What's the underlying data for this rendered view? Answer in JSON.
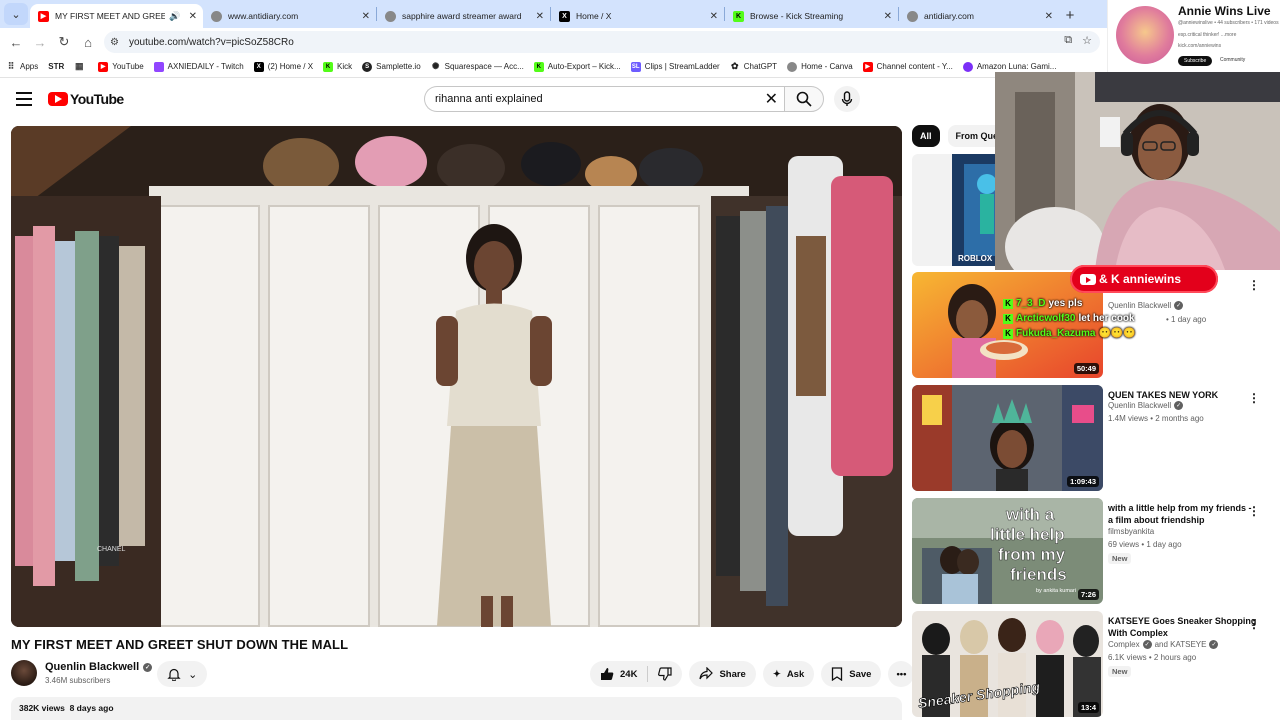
{
  "browser": {
    "tabs": [
      {
        "title": "MY FIRST MEET AND GREET SH",
        "icon": "youtube-icon",
        "active": true,
        "audio": true
      },
      {
        "title": "www.antidiary.com",
        "icon": "globe-icon"
      },
      {
        "title": "sapphire award streamer award",
        "icon": "globe-icon"
      },
      {
        "title": "Home / X",
        "icon": "x-icon"
      },
      {
        "title": "Browse - Kick Streaming",
        "icon": "kick-icon"
      },
      {
        "title": "antidiary.com",
        "icon": "globe-icon"
      }
    ],
    "url": "youtube.com/watch?v=picSoZ58CRo",
    "bookmarks": [
      {
        "label": "Apps",
        "icon": "apps-grid-icon"
      },
      {
        "label": "STR",
        "icon": "none"
      },
      {
        "label": "",
        "icon": "grid-icon"
      },
      {
        "label": "YouTube",
        "icon": "youtube-icon"
      },
      {
        "label": "AXNIEDAILY - Twitch",
        "icon": "twitch-icon"
      },
      {
        "label": "(2) Home / X",
        "icon": "x-icon"
      },
      {
        "label": "Kick",
        "icon": "kick-icon"
      },
      {
        "label": "Samplette.io",
        "icon": "samplette-icon"
      },
      {
        "label": "Squarespace — Acc...",
        "icon": "squarespace-icon"
      },
      {
        "label": "Auto-Export – Kick...",
        "icon": "kick-icon"
      },
      {
        "label": "Clips | StreamLadder",
        "icon": "streamladder-icon"
      },
      {
        "label": "ChatGPT",
        "icon": "chatgpt-icon"
      },
      {
        "label": "Home - Canva",
        "icon": "canva-icon"
      },
      {
        "label": "Channel content - Y...",
        "icon": "youtube-icon"
      },
      {
        "label": "Amazon Luna: Gami...",
        "icon": "luna-icon"
      }
    ]
  },
  "youtube": {
    "logo_text": "YouTube",
    "search_query": "rihanna anti explained",
    "video": {
      "title": "MY FIRST MEET AND GREET SHUT DOWN THE MALL",
      "watermark": "CHANEL",
      "channel": "Quenlin Blackwell",
      "subscribers": "3.46M subscribers",
      "likes": "24K",
      "share_label": "Share",
      "ask_label": "Ask",
      "save_label": "Save",
      "views": "382K views",
      "age": "8 days ago"
    },
    "chips": [
      {
        "label": "All",
        "selected": true
      },
      {
        "label": "From Quen",
        "selected": false
      }
    ],
    "recommendations": [
      {
        "title": "",
        "channel": "",
        "meta": "",
        "duration": "",
        "thumb_text": "ROBLOX"
      },
      {
        "title": "",
        "channel": "Quenlin Blackwell",
        "meta": "• 1 day ago",
        "duration": "50:49",
        "thumb_text": ""
      },
      {
        "title": "QUEN TAKES NEW YORK",
        "channel": "Quenlin Blackwell",
        "meta": "1.4M views • 2 months ago",
        "duration": "1:09:43",
        "thumb_text": ""
      },
      {
        "title": "with a little help from my friends - a film about friendship",
        "channel": "filmsbyankita",
        "meta": "69 views • 1 day ago",
        "duration": "7:26",
        "badge": "New",
        "thumb_text": "with a little help from my friends",
        "thumb_credit": "by ankita kumari"
      },
      {
        "title": "KATSEYE Goes Sneaker Shopping With Complex",
        "channel": "Complex",
        "channel_extra": "and KATSEYE",
        "meta": "6.1K views • 2 hours ago",
        "duration": "13:4",
        "badge": "New",
        "thumb_text": "Sneaker Shopping"
      }
    ]
  },
  "stream_overlay": {
    "streamer_name": "Annie Wins Live",
    "handle_line": "@anniewinslive • 44 subscribers • 171 videos",
    "bio_line": "esp.critical thinker! ...more",
    "link_line": "kick.com/anniewins",
    "subscribe_label": "Subscribe",
    "community_label": "Community",
    "badge_text": "& K anniewins",
    "chat": [
      {
        "user": "7_3_D",
        "message": "yes pls"
      },
      {
        "user": "Arcticwolf30",
        "message": "let her cook"
      },
      {
        "user": "Fukuda_Kazuma",
        "message": ""
      }
    ],
    "brand_color": "#e3001b",
    "kick_color": "#53fc18"
  }
}
